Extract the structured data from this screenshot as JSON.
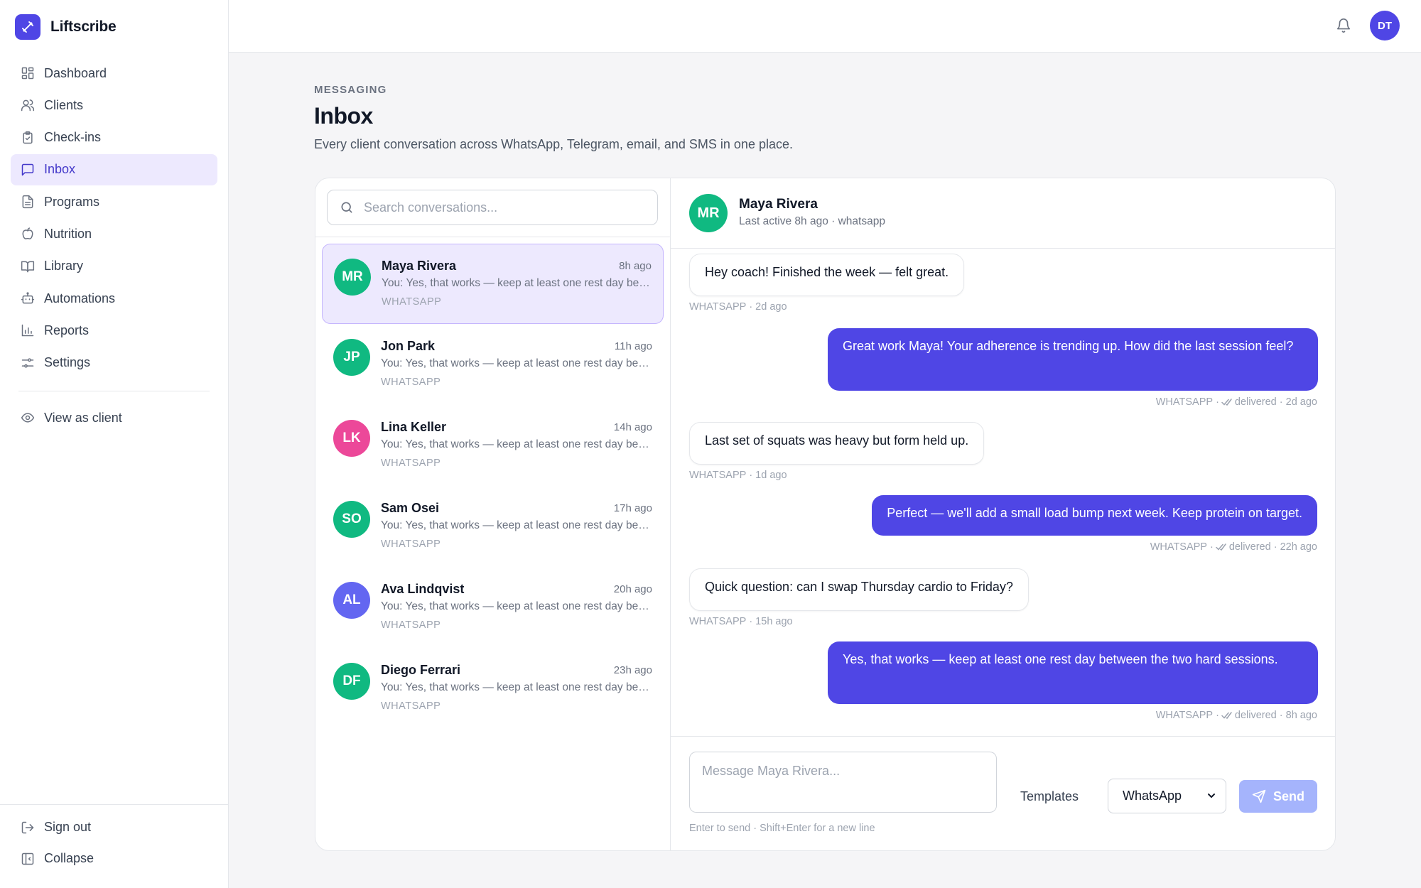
{
  "brand": {
    "name": "Liftscribe"
  },
  "nav": {
    "items": [
      {
        "label": "Dashboard",
        "icon": "dashboard-icon"
      },
      {
        "label": "Clients",
        "icon": "users-icon"
      },
      {
        "label": "Check-ins",
        "icon": "clipboard-check-icon"
      },
      {
        "label": "Inbox",
        "icon": "message-square-icon",
        "active": true
      },
      {
        "label": "Programs",
        "icon": "file-text-icon"
      },
      {
        "label": "Nutrition",
        "icon": "apple-icon"
      },
      {
        "label": "Library",
        "icon": "book-open-icon"
      },
      {
        "label": "Automations",
        "icon": "bot-icon"
      },
      {
        "label": "Reports",
        "icon": "bar-chart-icon"
      },
      {
        "label": "Settings",
        "icon": "sliders-icon"
      }
    ],
    "view_as_client": "View as client",
    "sign_out": "Sign out",
    "collapse": "Collapse"
  },
  "topbar": {
    "user_initials": "DT"
  },
  "header": {
    "eyebrow": "MESSAGING",
    "title": "Inbox",
    "description": "Every client conversation across WhatsApp, Telegram, email, and SMS in one place."
  },
  "search": {
    "placeholder": "Search conversations..."
  },
  "conversations": [
    {
      "initials": "MR",
      "name": "Maya Rivera",
      "time": "8h ago",
      "preview": "You: Yes, that works — keep at least one rest day between the two hard sessions.",
      "channel": "WHATSAPP",
      "color": "#10b981",
      "active": true
    },
    {
      "initials": "JP",
      "name": "Jon Park",
      "time": "11h ago",
      "preview": "You: Yes, that works — keep at least one rest day between the two hard sessions.",
      "channel": "WHATSAPP",
      "color": "#10b981"
    },
    {
      "initials": "LK",
      "name": "Lina Keller",
      "time": "14h ago",
      "preview": "You: Yes, that works — keep at least one rest day between the two hard sessions.",
      "channel": "WHATSAPP",
      "color": "#ec4899"
    },
    {
      "initials": "SO",
      "name": "Sam Osei",
      "time": "17h ago",
      "preview": "You: Yes, that works — keep at least one rest day between the two hard sessions.",
      "channel": "WHATSAPP",
      "color": "#10b981"
    },
    {
      "initials": "AL",
      "name": "Ava Lindqvist",
      "time": "20h ago",
      "preview": "You: Yes, that works — keep at least one rest day between the two hard sessions.",
      "channel": "WHATSAPP",
      "color": "#6366f1"
    },
    {
      "initials": "DF",
      "name": "Diego Ferrari",
      "time": "23h ago",
      "preview": "You: Yes, that works — keep at least one rest day between the two hard sessions.",
      "channel": "WHATSAPP",
      "color": "#10b981"
    }
  ],
  "chat": {
    "initials": "MR",
    "name": "Maya Rivera",
    "status": "Last active 8h ago · whatsapp",
    "messages": [
      {
        "dir": "in",
        "text": "Hey coach! Finished the week — felt great.",
        "channel": "WHATSAPP",
        "meta": "· 2d ago"
      },
      {
        "dir": "out",
        "text": "Great work Maya! Your adherence is trending up. How did the last session feel?",
        "channel": "WHATSAPP",
        "status": "delivered",
        "meta": "· 2d ago"
      },
      {
        "dir": "in",
        "text": "Last set of squats was heavy but form held up.",
        "channel": "WHATSAPP",
        "meta": "· 1d ago"
      },
      {
        "dir": "out",
        "text": "Perfect — we'll add a small load bump next week. Keep protein on target.",
        "channel": "WHATSAPP",
        "status": "delivered",
        "meta": "· 22h ago"
      },
      {
        "dir": "in",
        "text": "Quick question: can I swap Thursday cardio to Friday?",
        "channel": "WHATSAPP",
        "meta": "· 15h ago"
      },
      {
        "dir": "out",
        "text": "Yes, that works — keep at least one rest day between the two hard sessions.",
        "channel": "WHATSAPP",
        "status": "delivered",
        "meta": "· 8h ago"
      }
    ]
  },
  "compose": {
    "placeholder": "Message Maya Rivera...",
    "templates_label": "Templates",
    "channel_selected": "WhatsApp",
    "send_label": "Send",
    "hint": "Enter to send · Shift+Enter for a new line"
  }
}
